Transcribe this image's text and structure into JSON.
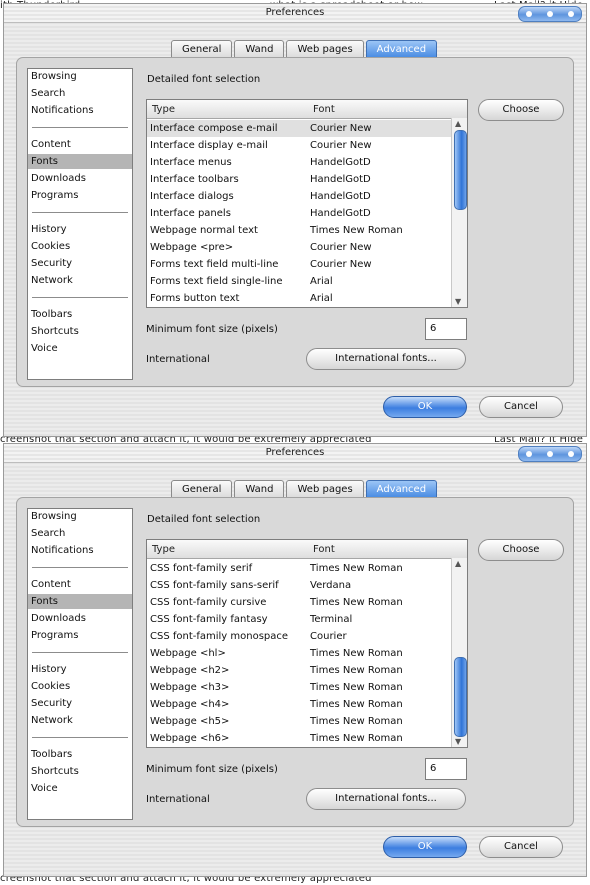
{
  "background": {
    "top_text": "ith Thunderbird",
    "top_text2": "what is a spreadsheet or how",
    "top_text3": "Last Mail? it Hide",
    "mid_text": "creenshot that section and attach it, it would be extremely appreciated",
    "mid_text2": "Last Mail? it Hide",
    "bottom_text": "creenshot that section and attach it, it would be extremely appreciated"
  },
  "windows": [
    {
      "title": "Preferences",
      "tabs": [
        "General",
        "Wand",
        "Web pages",
        "Advanced"
      ],
      "active_tab": 3,
      "categories": [
        "Browsing",
        "Search",
        "Notifications",
        "Content",
        "Fonts",
        "Downloads",
        "Programs",
        "History",
        "Cookies",
        "Security",
        "Network",
        "Toolbars",
        "Shortcuts",
        "Voice"
      ],
      "selected_category": 4,
      "section_title": "Detailed font selection",
      "list_headers": {
        "type": "Type",
        "font": "Font"
      },
      "rows": [
        {
          "type": "Interface compose e-mail",
          "font": "Courier New"
        },
        {
          "type": "Interface display e-mail",
          "font": "Courier New"
        },
        {
          "type": "Interface menus",
          "font": "HandelGotD"
        },
        {
          "type": "Interface toolbars",
          "font": "HandelGotD"
        },
        {
          "type": "Interface dialogs",
          "font": "HandelGotD"
        },
        {
          "type": "Interface panels",
          "font": "HandelGotD"
        },
        {
          "type": "Webpage normal text",
          "font": "Times New Roman"
        },
        {
          "type": "Webpage <pre>",
          "font": "Courier New"
        },
        {
          "type": "Forms text field multi-line",
          "font": "Courier New"
        },
        {
          "type": "Forms text field single-line",
          "font": "Arial"
        },
        {
          "type": "Forms button text",
          "font": "Arial"
        }
      ],
      "selected_row": 0,
      "scroll_position": 0.0,
      "choose_label": "Choose",
      "min_font_label": "Minimum font size (pixels)",
      "min_font_value": "6",
      "international_label": "International",
      "international_button": "International fonts...",
      "ok_label": "OK",
      "cancel_label": "Cancel"
    },
    {
      "title": "Preferences",
      "tabs": [
        "General",
        "Wand",
        "Web pages",
        "Advanced"
      ],
      "active_tab": 3,
      "categories": [
        "Browsing",
        "Search",
        "Notifications",
        "Content",
        "Fonts",
        "Downloads",
        "Programs",
        "History",
        "Cookies",
        "Security",
        "Network",
        "Toolbars",
        "Shortcuts",
        "Voice"
      ],
      "selected_category": 4,
      "section_title": "Detailed font selection",
      "list_headers": {
        "type": "Type",
        "font": "Font"
      },
      "rows": [
        {
          "type": "CSS font-family serif",
          "font": "Times New Roman"
        },
        {
          "type": "CSS font-family sans-serif",
          "font": "Verdana"
        },
        {
          "type": "CSS font-family cursive",
          "font": "Times New Roman"
        },
        {
          "type": "CSS font-family fantasy",
          "font": "Terminal"
        },
        {
          "type": "CSS font-family monospace",
          "font": "Courier"
        },
        {
          "type": "Webpage <hl>",
          "font": "Times New Roman"
        },
        {
          "type": "Webpage <h2>",
          "font": "Times New Roman"
        },
        {
          "type": "Webpage <h3>",
          "font": "Times New Roman"
        },
        {
          "type": "Webpage <h4>",
          "font": "Times New Roman"
        },
        {
          "type": "Webpage <h5>",
          "font": "Times New Roman"
        },
        {
          "type": "Webpage <h6>",
          "font": "Times New Roman"
        }
      ],
      "selected_row": -1,
      "scroll_position": 1.0,
      "choose_label": "Choose",
      "min_font_label": "Minimum font size (pixels)",
      "min_font_value": "6",
      "international_label": "International",
      "international_button": "International fonts...",
      "ok_label": "OK",
      "cancel_label": "Cancel"
    }
  ]
}
